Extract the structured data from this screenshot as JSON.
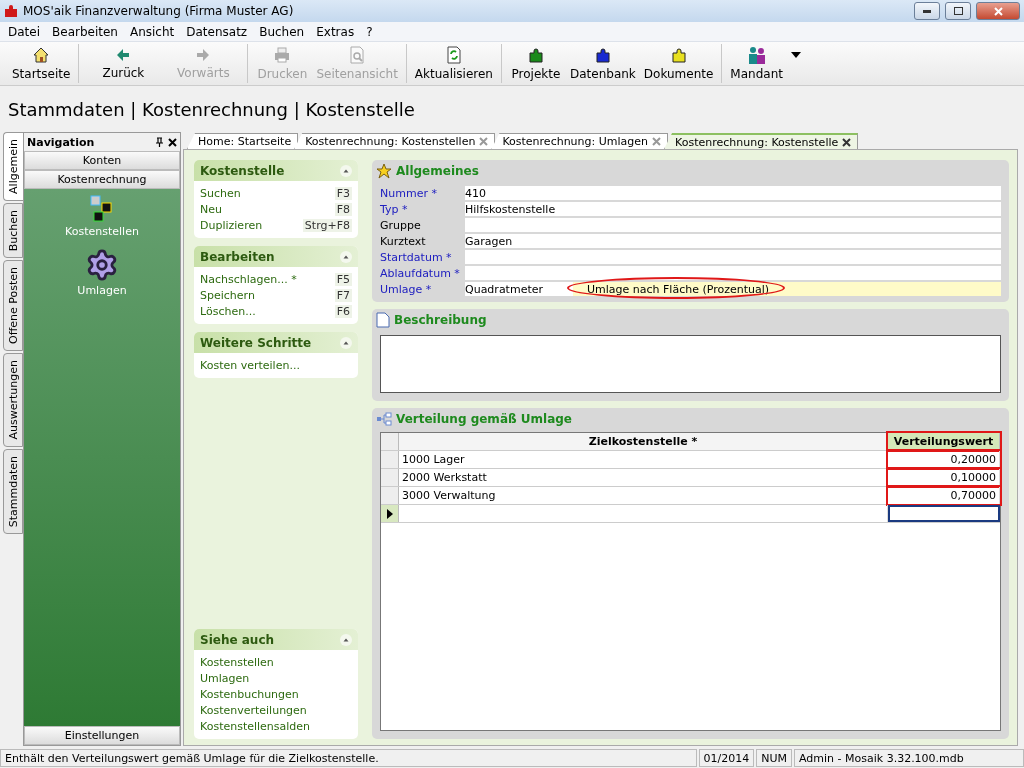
{
  "window": {
    "title": "MOS'aik Finanzverwaltung (Firma Muster AG)"
  },
  "menu": [
    {
      "label": "Datei"
    },
    {
      "label": "Bearbeiten"
    },
    {
      "label": "Ansicht"
    },
    {
      "label": "Datensatz"
    },
    {
      "label": "Buchen"
    },
    {
      "label": "Extras"
    },
    {
      "label": "?"
    }
  ],
  "toolbar": {
    "groups": [
      [
        {
          "kind": "home",
          "label": "Startseite",
          "disabled": false
        }
      ],
      [
        {
          "kind": "back",
          "label": "Zurück",
          "disabled": false
        },
        {
          "kind": "forward",
          "label": "Vorwärts",
          "disabled": true
        }
      ],
      [
        {
          "kind": "print",
          "label": "Drucken",
          "disabled": true
        },
        {
          "kind": "preview",
          "label": "Seitenansicht",
          "disabled": true
        }
      ],
      [
        {
          "kind": "refresh",
          "label": "Aktualisieren",
          "disabled": false
        }
      ],
      [
        {
          "kind": "puzzle",
          "label": "Projekte",
          "disabled": false,
          "color": "#1a8a1a"
        },
        {
          "kind": "puzzle",
          "label": "Datenbank",
          "disabled": false,
          "color": "#1a2ad0"
        },
        {
          "kind": "puzzle",
          "label": "Dokumente",
          "disabled": false,
          "color": "#e8e020"
        }
      ],
      [
        {
          "kind": "people",
          "label": "Mandant",
          "disabled": false,
          "dropdown": true
        }
      ]
    ]
  },
  "breadcrumb": "Stammdaten | Kostenrechnung | Kostenstelle",
  "side_tabs": [
    {
      "label": "Allgemein",
      "selected": true
    },
    {
      "label": "Buchen",
      "selected": false
    },
    {
      "label": "Offene Posten",
      "selected": false
    },
    {
      "label": "Auswertungen",
      "selected": false
    },
    {
      "label": "Stammdaten",
      "selected": false
    }
  ],
  "navigation": {
    "title": "Navigation",
    "sections": [
      "Konten",
      "Kostenrechnung"
    ],
    "items": [
      {
        "kind": "cost-centers",
        "label": "Kostenstellen"
      },
      {
        "kind": "allocations",
        "label": "Umlagen"
      }
    ],
    "footer": "Einstellungen"
  },
  "doc_tabs": [
    {
      "label": "Home: Startseite",
      "selected": false,
      "closable": false
    },
    {
      "label": "Kostenrechnung: Kostenstellen",
      "selected": false,
      "closable": true
    },
    {
      "label": "Kostenrechnung: Umlagen",
      "selected": false,
      "closable": true
    },
    {
      "label": "Kostenrechnung: Kostenstelle",
      "selected": true,
      "closable": true
    }
  ],
  "task_groups": [
    {
      "title": "Kostenstelle",
      "items": [
        {
          "label": "Suchen",
          "shortcut": "F3"
        },
        {
          "label": "Neu",
          "shortcut": "F8"
        },
        {
          "label": "Duplizieren",
          "shortcut": "Strg+F8"
        }
      ]
    },
    {
      "title": "Bearbeiten",
      "items": [
        {
          "label": "Nachschlagen... *",
          "shortcut": "F5"
        },
        {
          "label": "Speichern",
          "shortcut": "F7"
        },
        {
          "label": "Löschen...",
          "shortcut": "F6"
        }
      ]
    },
    {
      "title": "Weitere Schritte",
      "items": [
        {
          "label": "Kosten verteilen..."
        }
      ]
    }
  ],
  "see_also": {
    "title": "Siehe auch",
    "items": [
      "Kostenstellen",
      "Umlagen",
      "Kostenbuchungen",
      "Kostenverteilungen",
      "Kostenstellensalden"
    ]
  },
  "general": {
    "title": "Allgemeines",
    "fields": [
      {
        "label": "Nummer *",
        "required": true,
        "value": "410"
      },
      {
        "label": "Typ *",
        "required": true,
        "value": "Hilfskostenstelle"
      },
      {
        "label": "Gruppe",
        "required": false
      },
      {
        "label": "Kurztext",
        "required": false,
        "value": "Garagen"
      },
      {
        "label": "Startdatum *",
        "required": true
      },
      {
        "label": "Ablaufdatum *",
        "required": true
      },
      {
        "label": "Umlage *",
        "required": true,
        "value": "Quadratmeter",
        "description": "Umlage nach Fläche (Prozentual)",
        "circled": true
      }
    ]
  },
  "description": {
    "title": "Beschreibung"
  },
  "distribution": {
    "title": "Verteilung gemäß Umlage",
    "columns": [
      {
        "label": "Zielkostenstelle *",
        "boxed": false
      },
      {
        "label": "Verteilungswert",
        "boxed": true
      }
    ],
    "rows": [
      {
        "target": "1000 Lager",
        "value": "0,20000"
      },
      {
        "target": "2000 Werkstatt",
        "value": "0,10000"
      },
      {
        "target": "3000 Verwaltung",
        "value": "0,70000"
      }
    ]
  },
  "status_bar": {
    "message": "Enthält den Verteilungswert gemäß Umlage für die Zielkostenstelle.",
    "period": "01/2014",
    "num": "NUM",
    "database": "Admin - Mosaik 3.32.100.mdb"
  }
}
